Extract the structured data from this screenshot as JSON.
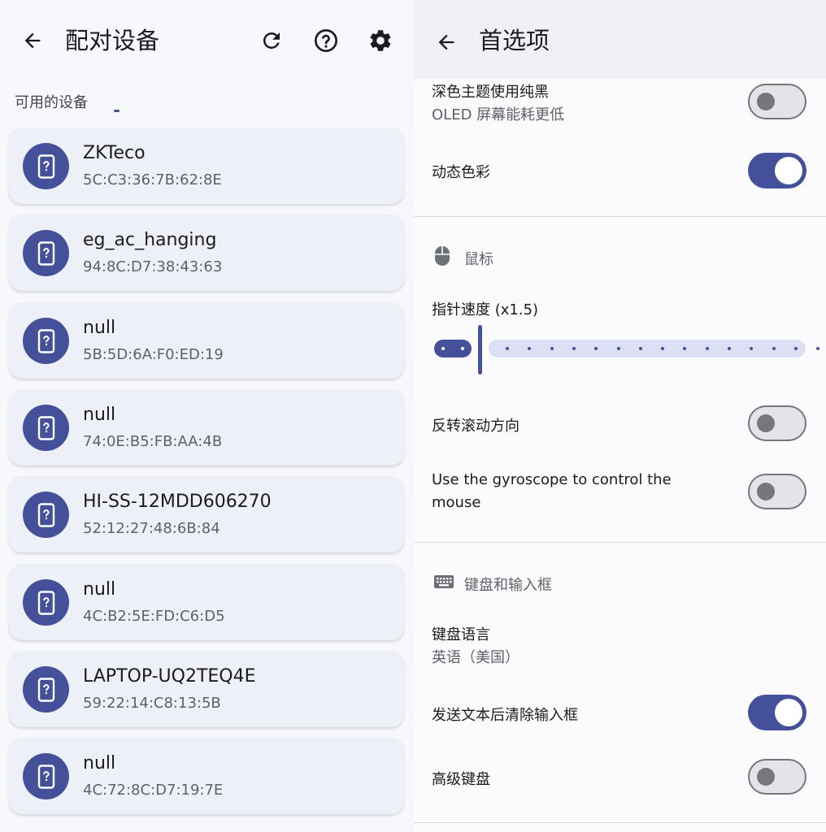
{
  "left": {
    "title": "配对设备",
    "section_label": "可用的设备",
    "icons": {
      "back": "arrow-back-icon",
      "refresh": "refresh-icon",
      "help": "help-circle-icon",
      "settings": "gear-icon",
      "device": "unknown-device-icon"
    },
    "devices": [
      {
        "name": "ZKTeco",
        "mac": "5C:C3:36:7B:62:8E"
      },
      {
        "name": "eg_ac_hanging",
        "mac": "94:8C:D7:38:43:63"
      },
      {
        "name": "null",
        "mac": "5B:5D:6A:F0:ED:19"
      },
      {
        "name": "null",
        "mac": "74:0E:B5:FB:AA:4B"
      },
      {
        "name": "HI-SS-12MDD606270",
        "mac": "52:12:27:48:6B:84"
      },
      {
        "name": "null",
        "mac": "4C:B2:5E:FD:C6:D5"
      },
      {
        "name": "LAPTOP-UQ2TEQ4E",
        "mac": "59:22:14:C8:13:5B"
      },
      {
        "name": "null",
        "mac": "4C:72:8C:D7:19:7E"
      }
    ]
  },
  "right": {
    "title": "首选项",
    "pure_black": {
      "label": "深色主题使用纯黑",
      "sub": "OLED 屏幕能耗更低",
      "on": false
    },
    "dynamic_color": {
      "label": "动态色彩",
      "on": true
    },
    "mouse_section": {
      "title": "鼠标",
      "icon": "mouse-icon"
    },
    "pointer_speed": {
      "label": "指针速度 (x1.5)",
      "value": 1.5,
      "steps": 15
    },
    "reverse_scroll": {
      "label": "反转滚动方向",
      "on": false
    },
    "gyroscope": {
      "label_line1": "Use the gyroscope to control the",
      "label_line2": "mouse",
      "on": false
    },
    "keyboard_section": {
      "title": "键盘和输入框",
      "icon": "keyboard-icon"
    },
    "keyboard_language": {
      "label": "键盘语言",
      "value": "英语（美国）"
    },
    "clear_after_send": {
      "label": "发送文本后清除输入框",
      "on": true
    },
    "advanced_keyboard": {
      "label": "高级键盘",
      "on": false
    }
  },
  "colors": {
    "accent": "#44519a",
    "card": "#eef0f8",
    "track": "#dde0f4"
  }
}
